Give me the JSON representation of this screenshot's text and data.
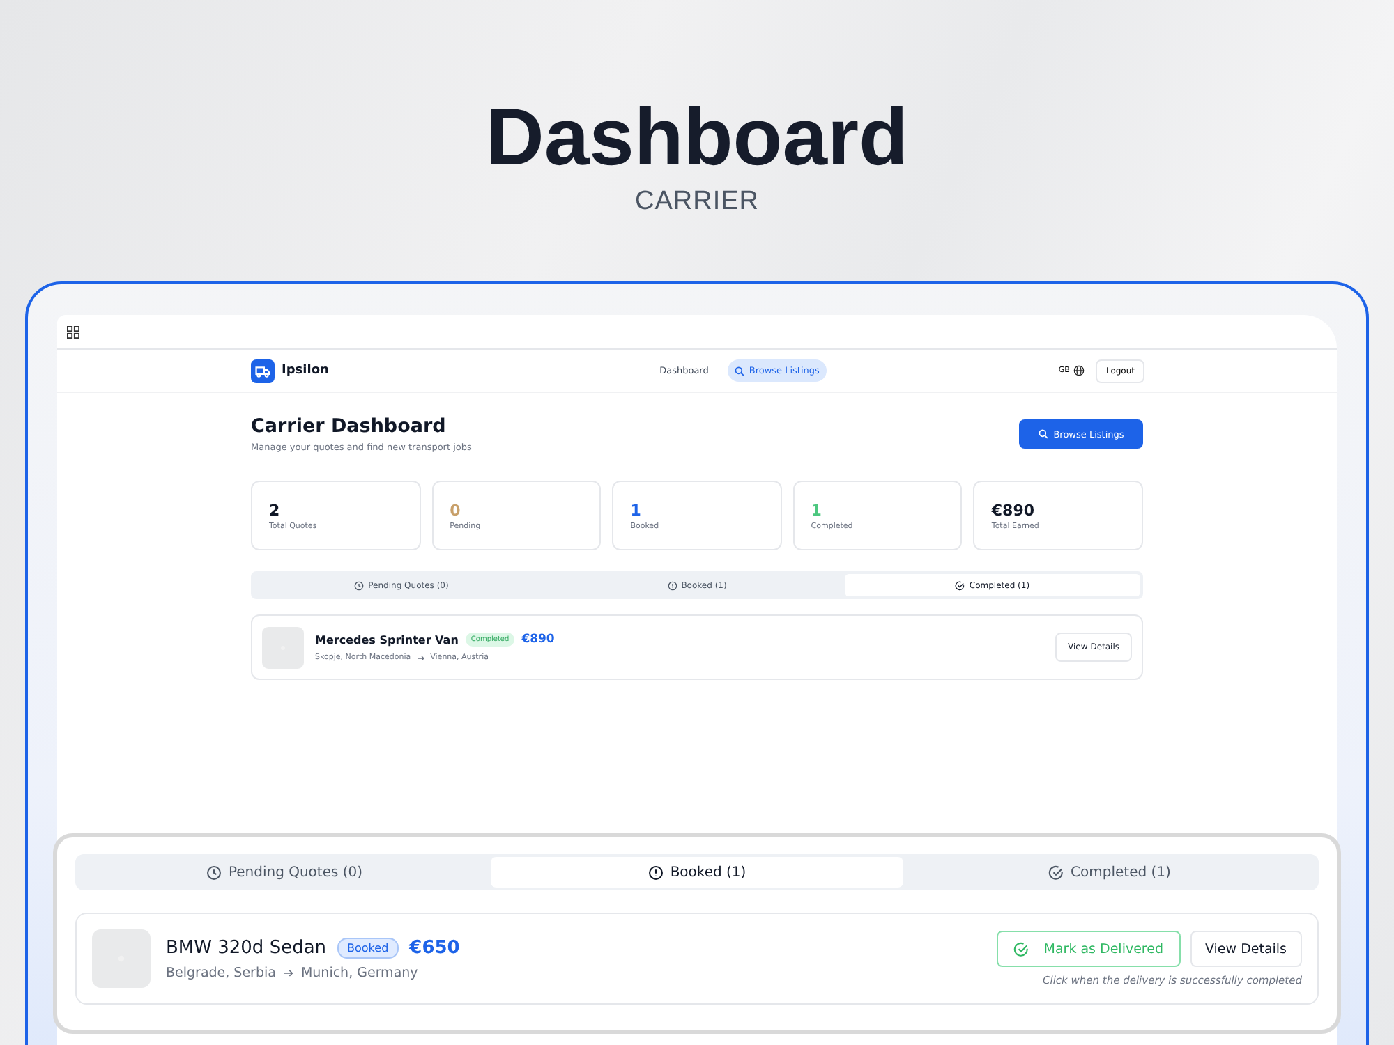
{
  "hero": {
    "title": "Dashboard",
    "subtitle": "CARRIER"
  },
  "app": {
    "brand": "Ipsilon",
    "nav": [
      {
        "label": "Dashboard",
        "kind": "plain",
        "selected": false
      },
      {
        "label": "Browse Listings",
        "kind": "search",
        "selected": true
      }
    ],
    "language": "GB",
    "logout": "Logout",
    "heading": "Carrier Dashboard",
    "subheading": "Manage your quotes and find new transport jobs",
    "primary_action": "Browse Listings",
    "stats": [
      {
        "value": "2",
        "label": "Total Quotes",
        "color": "#111827"
      },
      {
        "value": "0",
        "label": "Pending",
        "color": "#c8a06a"
      },
      {
        "value": "1",
        "label": "Booked",
        "color": "#1d63e8"
      },
      {
        "value": "1",
        "label": "Completed",
        "color": "#4cc77f"
      },
      {
        "value": "€890",
        "label": "Total Earned",
        "color": "#111827"
      }
    ],
    "tabs": [
      {
        "label": "Pending Quotes (0)",
        "kind": "clock",
        "selected": false
      },
      {
        "label": "Booked (1)",
        "kind": "alert",
        "selected": false
      },
      {
        "label": "Completed (1)",
        "kind": "check",
        "selected": true
      }
    ],
    "listings": [
      {
        "title": "Mercedes Sprinter Van",
        "status": {
          "label": "Completed",
          "kind": "completed"
        },
        "price": "€890",
        "from": "Skopje, North Macedonia",
        "to": "Vienna, Austria",
        "details_action": "View Details"
      }
    ]
  },
  "zoom": {
    "tabs": [
      {
        "label": "Pending Quotes (0)",
        "kind": "clock",
        "selected": false
      },
      {
        "label": "Booked (1)",
        "kind": "alert",
        "selected": true
      },
      {
        "label": "Completed (1)",
        "kind": "check",
        "selected": false
      }
    ],
    "listings": [
      {
        "title": "BMW 320d Sedan",
        "status": {
          "label": "Booked",
          "kind": "booked"
        },
        "price": "€650",
        "from": "Belgrade, Serbia",
        "to": "Munich, Germany",
        "deliver_action": "Mark as Delivered",
        "details_action": "View Details",
        "hint": "Click when the delivery is successfully completed"
      }
    ]
  }
}
